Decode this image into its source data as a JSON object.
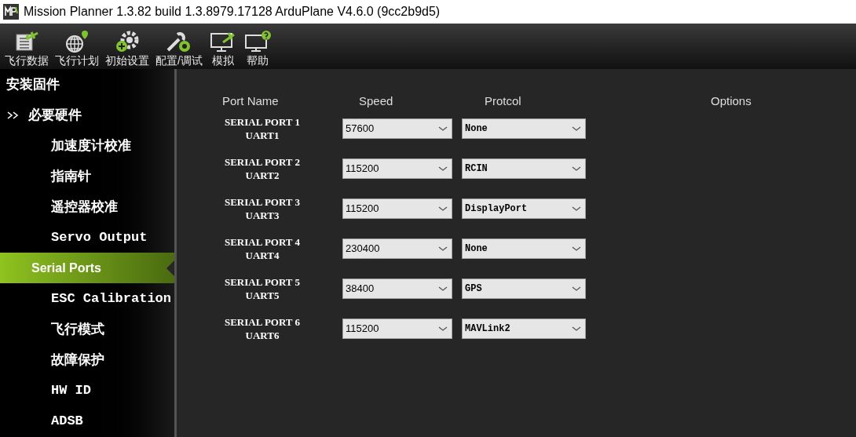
{
  "window": {
    "title": "Mission Planner 1.3.82 build 1.3.8979.17128 ArduPlane V4.6.0 (9cc2b9d5)"
  },
  "toolbar": [
    {
      "kind": "flight-data",
      "label": "飞行数据"
    },
    {
      "kind": "flight-plan",
      "label": "飞行计划"
    },
    {
      "kind": "initial-setup",
      "label": "初始设置"
    },
    {
      "kind": "config",
      "label": "配置/调试"
    },
    {
      "kind": "simulation",
      "label": "模拟"
    },
    {
      "kind": "help",
      "label": "帮助"
    }
  ],
  "sidebar": {
    "items": [
      {
        "label": "安装固件",
        "selected": false
      },
      {
        "label": "必要硬件",
        "selected": false,
        "expanded": true,
        "children": [
          {
            "label": "加速度计校准",
            "selected": false
          },
          {
            "label": "指南针",
            "selected": false
          },
          {
            "label": "遥控器校准",
            "selected": false
          },
          {
            "label": "Servo Output",
            "selected": false
          },
          {
            "label": "Serial Ports",
            "selected": true
          },
          {
            "label": "ESC Calibration",
            "selected": false
          },
          {
            "label": "飞行模式",
            "selected": false
          },
          {
            "label": "故障保护",
            "selected": false
          },
          {
            "label": "HW ID",
            "selected": false
          },
          {
            "label": "ADSB",
            "selected": false
          }
        ]
      }
    ]
  },
  "table": {
    "columns": [
      "Port Name",
      "Speed",
      "Protcol",
      "Options"
    ],
    "rows": [
      {
        "port": "SERIAL PORT 1",
        "uart": "UART1",
        "speed": "57600",
        "protocol": "None"
      },
      {
        "port": "SERIAL PORT 2",
        "uart": "UART2",
        "speed": "115200",
        "protocol": "RCIN"
      },
      {
        "port": "SERIAL PORT 3",
        "uart": "UART3",
        "speed": "115200",
        "protocol": "DisplayPort"
      },
      {
        "port": "SERIAL PORT 4",
        "uart": "UART4",
        "speed": "230400",
        "protocol": "None"
      },
      {
        "port": "SERIAL PORT 5",
        "uart": "UART5",
        "speed": "38400",
        "protocol": "GPS"
      },
      {
        "port": "SERIAL PORT 6",
        "uart": "UART6",
        "speed": "115200",
        "protocol": "MAVLink2"
      }
    ]
  }
}
